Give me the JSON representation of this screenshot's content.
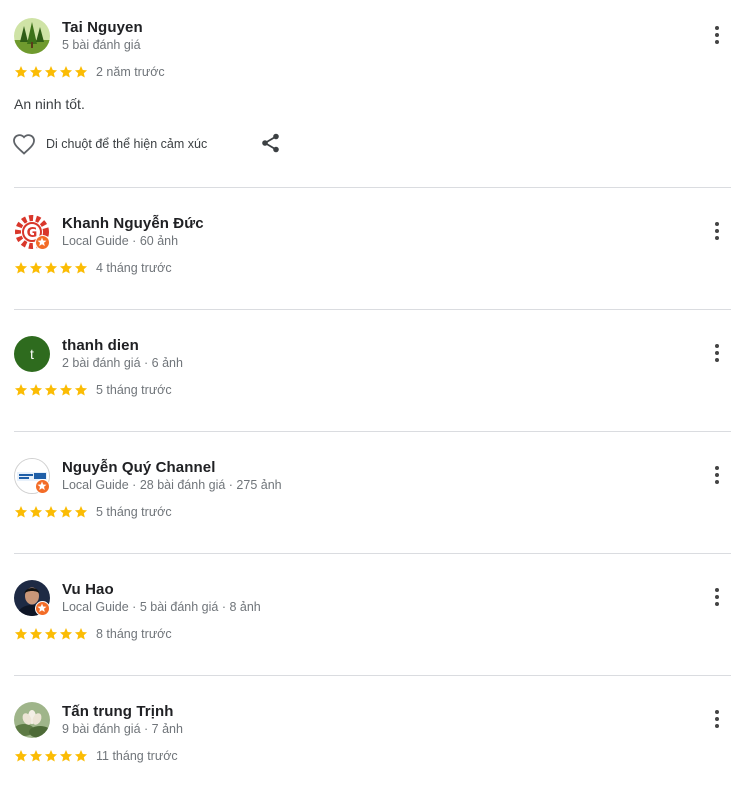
{
  "reviews": [
    {
      "name": "Tai Nguyen",
      "meta": "5 bài đánh giá",
      "rating": 5,
      "time": "2 năm trước",
      "text": "An ninh tốt.",
      "reaction_hint": "Di chuột để thể hiện cảm xúc",
      "avatar": "forest-photo"
    },
    {
      "name": "Khanh Nguyễn Đức",
      "meta": "Local Guide · 60 ảnh",
      "rating": 5,
      "time": "4 tháng trước",
      "avatar": "gear-logo"
    },
    {
      "name": "thanh dien",
      "meta": "2 bài đánh giá · 6 ảnh",
      "rating": 5,
      "time": "5 tháng trước",
      "avatar_letter": "t",
      "avatar_color": "#2e6b1e"
    },
    {
      "name": "Nguyễn Quý Channel",
      "meta": "Local Guide · 28 bài đánh giá · 275 ảnh",
      "rating": 5,
      "time": "5 tháng trước",
      "avatar": "net-logo"
    },
    {
      "name": "Vu Hao",
      "meta": "Local Guide · 5 bài đánh giá · 8 ảnh",
      "rating": 5,
      "time": "8 tháng trước",
      "avatar": "person-photo"
    },
    {
      "name": "Tấn trung Trịnh",
      "meta": "9 bài đánh giá · 7 ảnh",
      "rating": 5,
      "time": "11 tháng trước",
      "avatar": "flower-photo"
    }
  ],
  "colors": {
    "star": "#fbbc04",
    "meta_text": "#70757a",
    "divider": "#dadce0",
    "local_guide_badge": "#f36c27"
  },
  "icons": {
    "more": "more-vert-icon",
    "react": "heart-outline-icon",
    "share": "share-icon",
    "star": "star-filled-icon",
    "local_guide": "local-guide-badge-icon"
  }
}
